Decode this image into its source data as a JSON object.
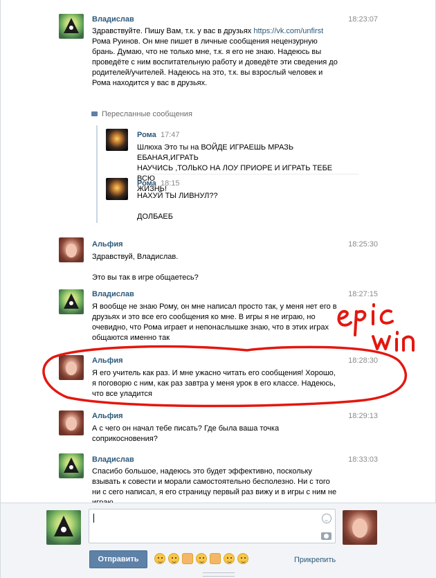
{
  "messages": [
    {
      "author": "Владислав",
      "time": "18:23:07",
      "text_before_link": "Здравствуйте. Пишу Вам, т.к. у вас в друзьях ",
      "link": "https://vk.com/unfirst",
      "text_after_link": "\nРома Руинов. Он мне пишет в личные сообщения нецензурную\nбрань. Думаю, что не только мне, т.к. я его не знаю. Надеюсь вы\nпроведёте с ним воспитательную работу и доведёте эти сведения до\nродителей/учителей. Надеюсь на это, т.к. вы взрослый человек и\nРома находится у вас в друзьях."
    },
    {
      "author": "Альфия",
      "time": "18:25:30",
      "text": "Здравствуй, Владислав.\n\nЭто вы так в игре общаетесь?"
    },
    {
      "author": "Владислав",
      "time": "18:27:15",
      "text": "Я вообще не знаю Рому, он мне написал просто так, у меня нет его в\nдрузьях и это все его сообщения ко мне. В игры я не играю, но\nочевидно, что Рома играет и непонаслышке знаю, что в этих играх\nобщаются именно так"
    },
    {
      "author": "Альфия",
      "time": "18:28:30",
      "text": "Я его учитель как раз. И мне ужасно читать его сообщения! Хорошо,\nя поговорю с ним, как раз завтра у меня урок в его классе. Надеюсь,\nчто все уладится"
    },
    {
      "author": "Альфия",
      "time": "18:29:13",
      "text": "А с чего он начал тебе писать? Где была ваша точка\nсоприкосновения?"
    },
    {
      "author": "Владислав",
      "time": "18:33:03",
      "text": "Спасибо большое, надеюсь это будет эффективно, поскольку\nвзывать к совести и морали самостоятельно бесполезно. Ни с того\nни с сего написал, я его страницу первый раз вижу и в игры с ним не\nиграю."
    }
  ],
  "forwarded": {
    "label": "Пересланные сообщения",
    "items": [
      {
        "author": "Рома",
        "time": "17:47",
        "text": "Шлюха Это ты на ВОЙДЕ ИГРАЕШЬ МРАЗЬ ЕБАНАЯ,ИГРАТЬ\nНАУЧИСЬ ,ТОЛЬКО НА ЛОУ ПРИОРЕ И ИГРАТЬ ТЕБЕ ВСЮ\nЖИЗНЬ!"
      },
      {
        "author": "Рома",
        "time": "18:15",
        "text": "НАХУЙ ТЫ ЛИВНУЛ??\n\nДОЛБАЕБ"
      }
    ]
  },
  "annotation": {
    "text": "epic win",
    "color": "#e3170f"
  },
  "composer": {
    "input_value": "",
    "send_label": "Отправить",
    "attach_label": "Прикрепить",
    "emoji_icons": [
      "joy-emoji-icon",
      "grin-emoji-icon",
      "thumbs-up-emoji-icon",
      "smile-emoji-icon",
      "thumbs-up-emoji-icon",
      "relieved-emoji-icon",
      "laughing-emoji-icon"
    ]
  },
  "colors": {
    "link": "#2b587a",
    "send_button": "#5e81a8",
    "annotation": "#e3170f"
  }
}
